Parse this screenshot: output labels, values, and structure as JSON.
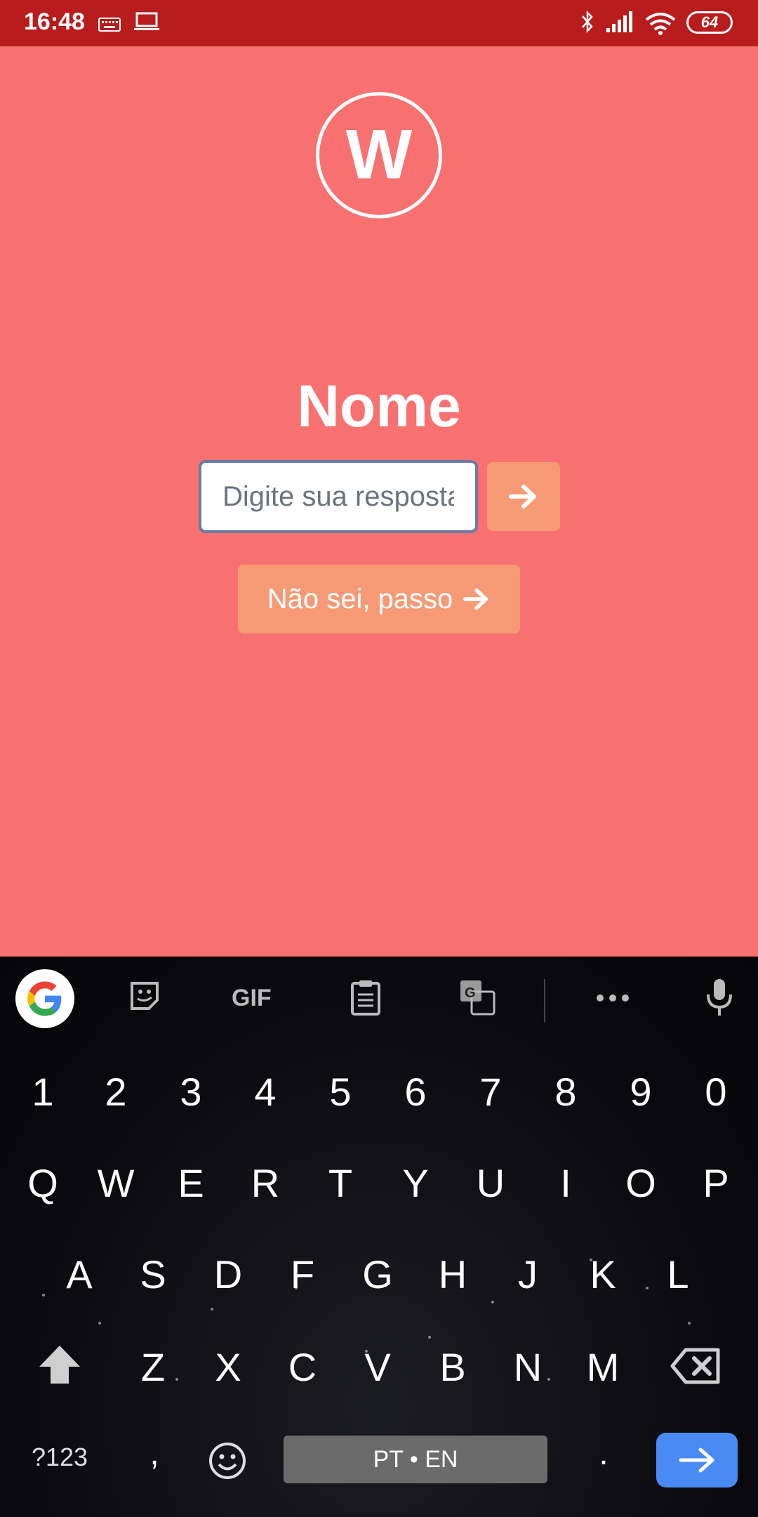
{
  "status_bar": {
    "time": "16:48",
    "battery": "64",
    "icons": [
      "keyboard-icon",
      "laptop-icon",
      "bluetooth-icon",
      "signal-icon",
      "wifi-icon",
      "battery-icon"
    ]
  },
  "logo": {
    "letter": "W"
  },
  "question": {
    "title": "Nome"
  },
  "answer": {
    "placeholder": "Digite sua resposta",
    "value": ""
  },
  "skip_button": {
    "label": "Não sei, passo"
  },
  "keyboard": {
    "toolbar": [
      "google-icon",
      "sticker-icon",
      "gif-icon",
      "clipboard-icon",
      "translate-icon",
      "more-icon",
      "mic-icon"
    ],
    "gif_label": "GIF",
    "number_row": [
      "1",
      "2",
      "3",
      "4",
      "5",
      "6",
      "7",
      "8",
      "9",
      "0"
    ],
    "row1": [
      "Q",
      "W",
      "E",
      "R",
      "T",
      "Y",
      "U",
      "I",
      "O",
      "P"
    ],
    "row2": [
      "A",
      "S",
      "D",
      "F",
      "G",
      "H",
      "J",
      "K",
      "L"
    ],
    "row3": [
      "Z",
      "X",
      "C",
      "V",
      "B",
      "N",
      "M"
    ],
    "symbols_key": "?123",
    "comma_key": ",",
    "space_label": "PT • EN",
    "period_key": "."
  },
  "colors": {
    "background": "#F87171",
    "status_bar": "#B91C1C",
    "button": "#F59A75",
    "enter_key": "#4A8AF4"
  }
}
